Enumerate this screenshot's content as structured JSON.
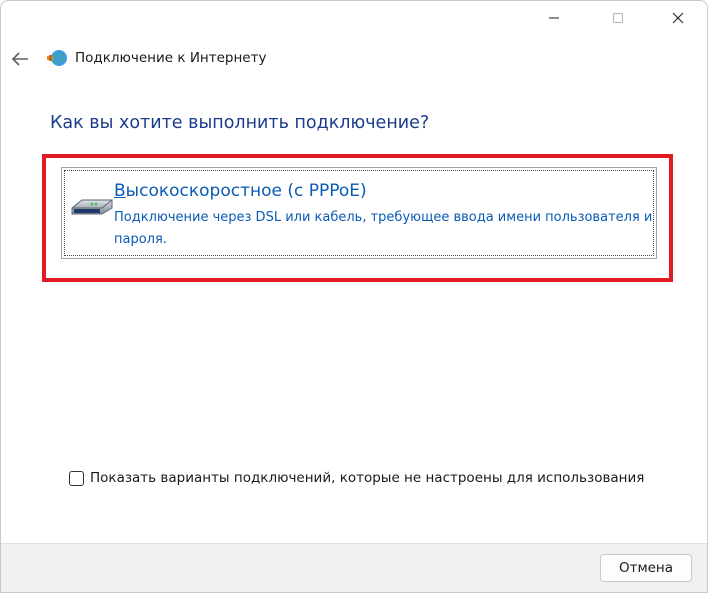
{
  "window": {
    "controls": {
      "minimize_icon": "minimize-icon",
      "maximize_icon": "maximize-icon",
      "close_icon": "close-icon"
    }
  },
  "nav": {
    "back_icon": "back-arrow-icon",
    "app_icon": "network-globe-icon",
    "title": "Подключение к Интернету"
  },
  "main": {
    "heading": "Как вы хотите выполнить подключение?",
    "option": {
      "icon": "modem-icon",
      "title_underlined": "В",
      "title_rest": "ысокоскоростное (с PPPoE)",
      "description": "Подключение через DSL или кабель, требующее ввода имени пользователя и пароля."
    },
    "show_all_checkbox": {
      "checked": false,
      "label": "Показать варианты подключений, которые не настроены для использования"
    }
  },
  "footer": {
    "cancel_label": "Отмена"
  },
  "colors": {
    "heading": "#1b3c8c",
    "link": "#0a5bb5",
    "highlight_frame": "#e11b24",
    "footer_bg": "#f0f0f0"
  }
}
